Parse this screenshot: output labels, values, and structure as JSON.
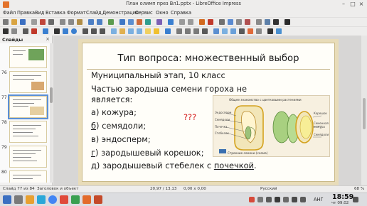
{
  "window": {
    "title": "План олимп през Вл1.pptx - LibreOffice Impress"
  },
  "menu": [
    "Файл",
    "Правка",
    "Вид",
    "Вставка",
    "Формат",
    "Слайд",
    "Демонстрация",
    "Сервис",
    "Окно",
    "Справка"
  ],
  "sidebar": {
    "title": "Слайды",
    "slides": [
      {
        "num": ""
      },
      {
        "num": "76"
      },
      {
        "num": "77",
        "selected": true
      },
      {
        "num": "78"
      },
      {
        "num": "79"
      },
      {
        "num": "80"
      }
    ]
  },
  "slide": {
    "title": "Тип вопроса: множественный выбор",
    "subtitle": "Муниципальный этап, 10 класс",
    "question_line1": "Частью зародыша семени гороха не",
    "question_line2": "является:",
    "options": {
      "a": "а) кожура;",
      "b_letter": "б",
      "b_rest": ") семядоли;",
      "v": "в) эндосперм;",
      "g_letter": "г",
      "g_rest": ") зародышевый корешок;",
      "d_pre": "д) зародышевый стебелек с ",
      "d_ul": "почечкой",
      "d_post": "."
    },
    "marks": "???"
  },
  "diagram": {
    "header": "Общее знакомство с цветковыми растениями",
    "footer": "Строение семени (схема)",
    "labels": [
      "Эндосперм",
      "Семядоли",
      "Почечка",
      "Стебелек",
      "Корешок",
      "Семенная кожура",
      "Семядоли"
    ]
  },
  "status": {
    "slide_info": "Слайд 77 из 84",
    "layout": "Заголовок и объект",
    "position": "20,97 / 13,13",
    "size": "0,00 x 0,00",
    "language": "Русский",
    "zoom": "68 %"
  },
  "taskbar": {
    "keyboard": "АНГ",
    "time": "18:59",
    "date": "чт 09.02"
  }
}
